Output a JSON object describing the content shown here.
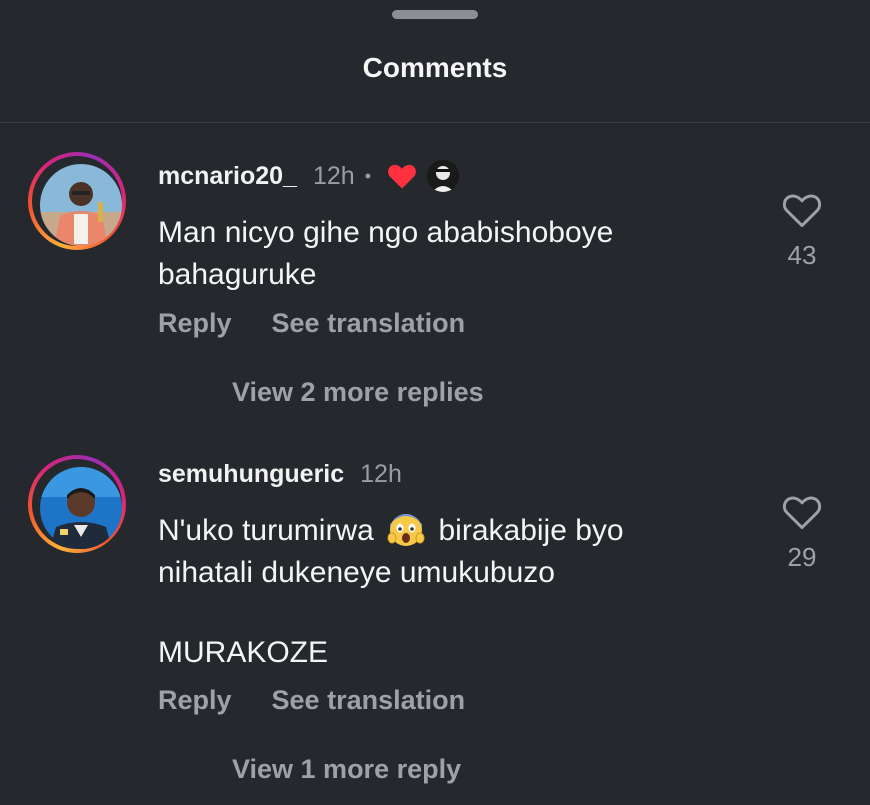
{
  "sheet": {
    "title": "Comments"
  },
  "comments": [
    {
      "username": "mcnario20_",
      "time": "12h",
      "separator": "•",
      "text_lines": [
        "Man nicyo gihe ngo ababishoboye",
        "bahaguruke"
      ],
      "reply_label": "Reply",
      "translate_label": "See translation",
      "view_replies": "View 2 more replies",
      "likes": "43",
      "liked_by_author": true
    },
    {
      "username": "semuhungueric",
      "time": "12h",
      "text_line1_before": "N'uko turumirwa",
      "text_line1_emoji": "face-screaming-in-fear",
      "text_line1_after": "birakabije byo",
      "text_line2": "nihatali dukeneye umukubuzo",
      "text_line3": "MURAKOZE",
      "reply_label": "Reply",
      "translate_label": "See translation",
      "view_replies": "View 1 more reply",
      "likes": "29"
    }
  ],
  "colors": {
    "background": "#25282c",
    "muted_text": "#9ea2a7",
    "like_red": "#ff3040"
  }
}
